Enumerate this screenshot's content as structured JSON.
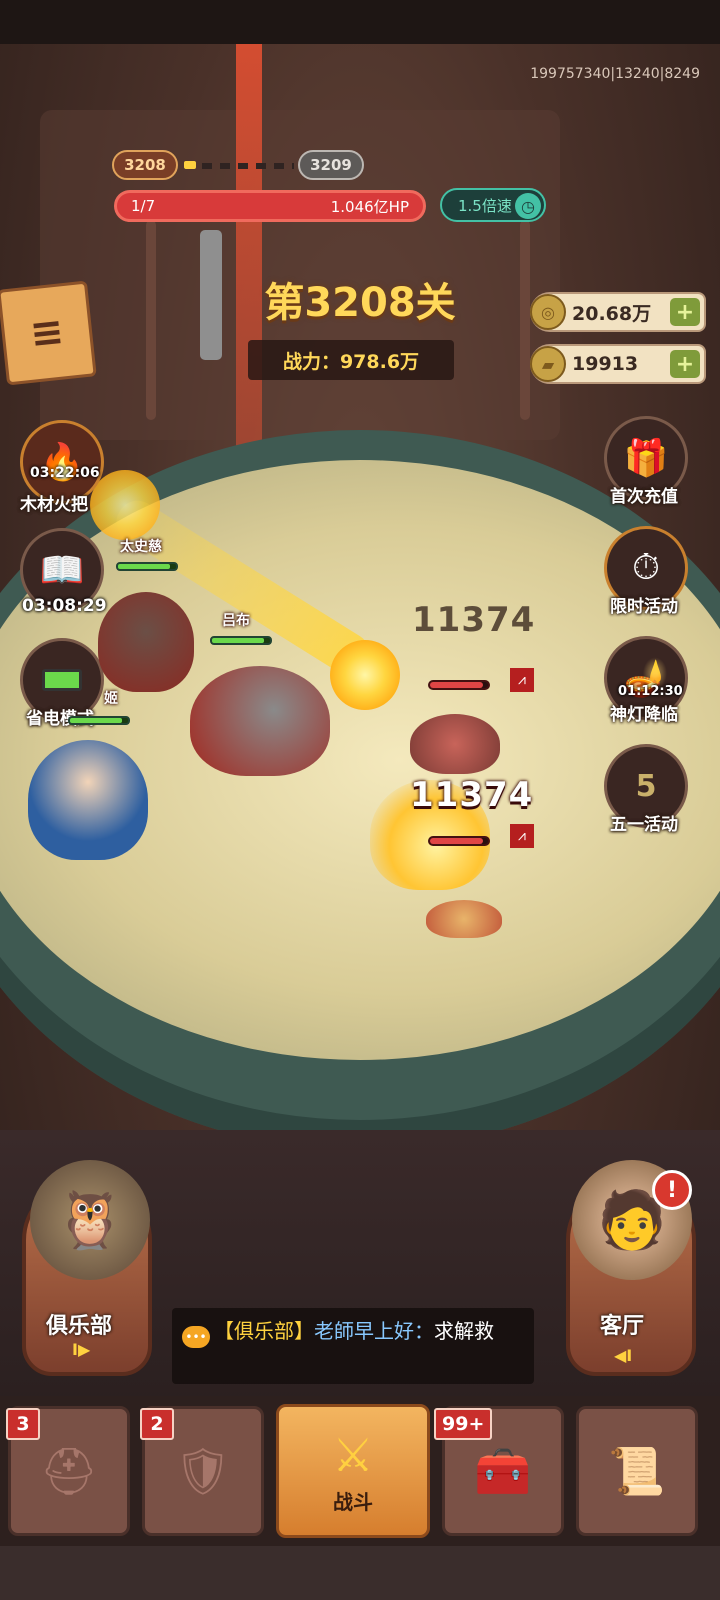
{
  "account_info": "199757340|13240|8249",
  "stage_progress": {
    "current": "3208",
    "next": "3209"
  },
  "boss_hp": {
    "wave": "1/7",
    "hp": "1.046亿HP"
  },
  "speed": {
    "label": "1.5倍速"
  },
  "stage": {
    "title": "第3208关",
    "power": "战力：978.6万"
  },
  "currency": {
    "gold": "20.68万",
    "gold_ingot": "19913"
  },
  "left_side": [
    {
      "label": "木材火把",
      "timer": "03:22:06"
    },
    {
      "label": "",
      "timer": "03:08:29"
    },
    {
      "label": "省电模式",
      "timer": ""
    }
  ],
  "right_side": [
    {
      "label": "首次充值",
      "timer": ""
    },
    {
      "label": "限时活动",
      "timer": ""
    },
    {
      "label": "神灯降临",
      "timer": "01:12:30"
    },
    {
      "label": "五一活动",
      "timer": ""
    }
  ],
  "units": {
    "hero1": "太史慈",
    "hero2": "吕布",
    "hero3": "姬"
  },
  "damage": {
    "back": "11374",
    "front": "11374"
  },
  "club": {
    "label": "俱乐部",
    "arrow": "I▶"
  },
  "lobby": {
    "label": "客厅",
    "arrow": "◀I",
    "alert": "!"
  },
  "chat": {
    "channel": "【俱乐部】",
    "sender": "老師早上好：",
    "message": "求解救"
  },
  "tabs": [
    {
      "badge": "3",
      "label": ""
    },
    {
      "badge": "2",
      "label": ""
    },
    {
      "badge": "",
      "label": "战斗"
    },
    {
      "badge": "99+",
      "label": ""
    },
    {
      "badge": "",
      "label": ""
    }
  ],
  "colors": {
    "accent_gold": "#ffd85a",
    "hp_red": "#d83a3a",
    "speed_teal": "#43c1a5",
    "unit_hp_green": "#6bd94b"
  }
}
